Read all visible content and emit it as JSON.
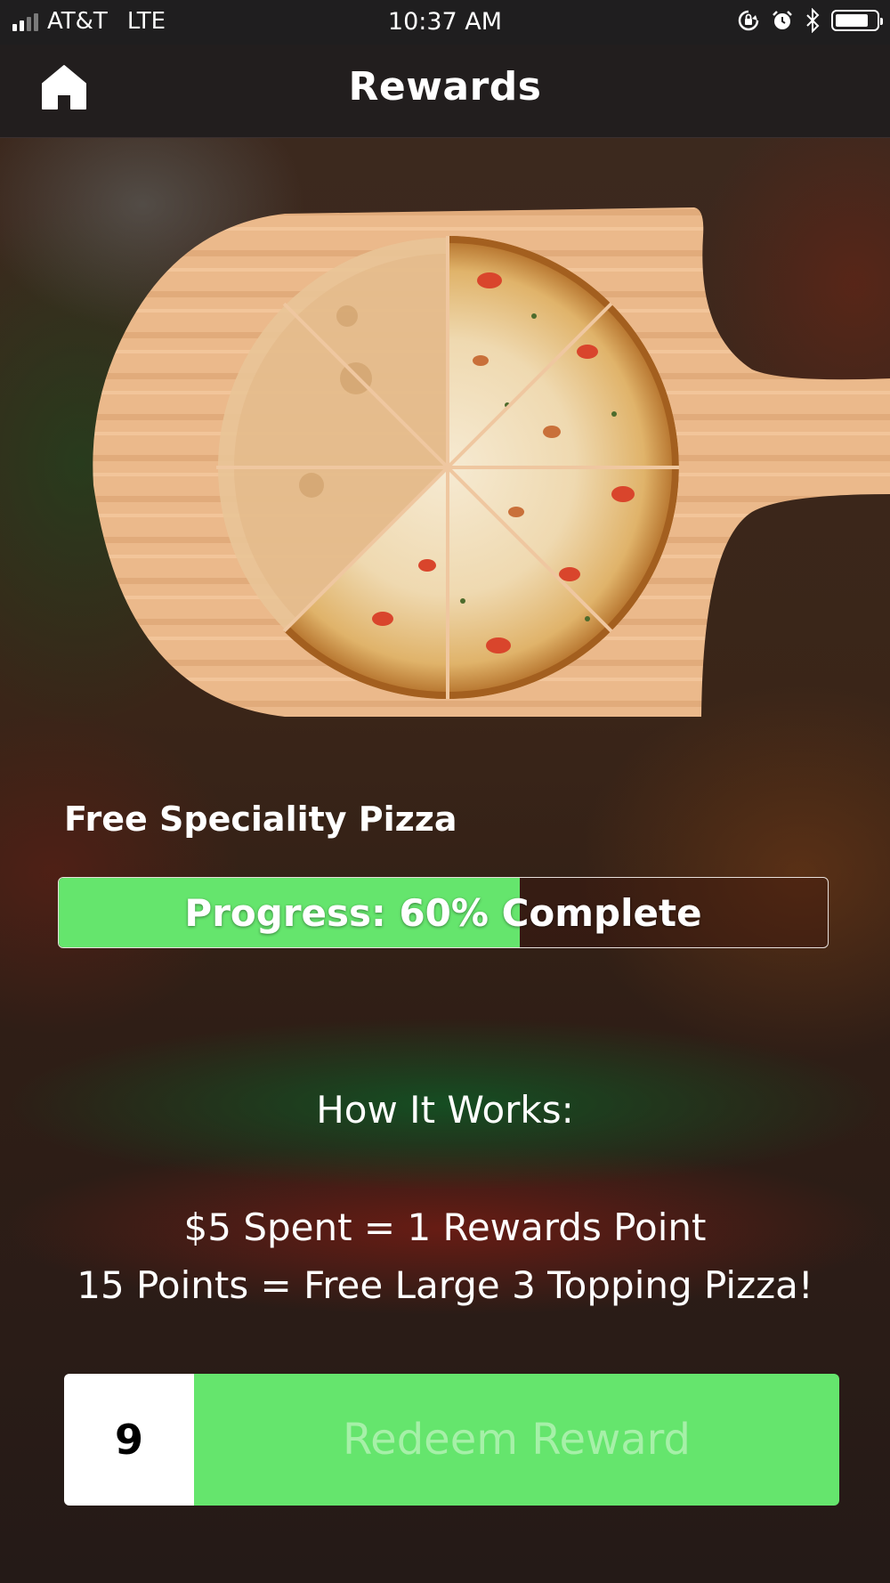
{
  "status_bar": {
    "carrier": "AT&T",
    "network": "LTE",
    "time": "10:37 AM",
    "icons": [
      "signal-icon",
      "orientation-lock-icon",
      "alarm-icon",
      "bluetooth-icon",
      "battery-icon"
    ]
  },
  "nav": {
    "title": "Rewards",
    "home_icon": "home-icon"
  },
  "reward": {
    "name": "Free Speciality Pizza",
    "progress_text": "Progress: 60% Complete",
    "progress_fraction": 0.6,
    "slices_earned": 5,
    "slices_total": 8
  },
  "how_it_works": {
    "title": "How It Works:",
    "rule1": "$5 Spent = 1 Rewards Point",
    "rule2": "15 Points = Free Large 3 Topping Pizza!"
  },
  "redeem": {
    "points": "9",
    "label": "Redeem Reward"
  },
  "colors": {
    "accent_green": "#65e56d",
    "nav_bar": "#221e1e",
    "status_bar": "#1f1e1f"
  }
}
